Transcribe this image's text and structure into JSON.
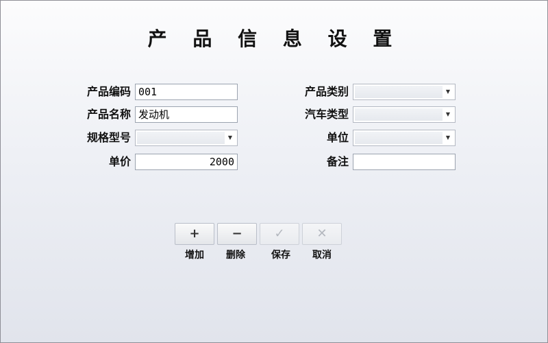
{
  "window": {
    "title": "产 品 信 息 设 置"
  },
  "form": {
    "product_code": {
      "label": "产品编码",
      "value": "001"
    },
    "product_name": {
      "label": "产品名称",
      "value": "发动机"
    },
    "spec_model": {
      "label": "规格型号",
      "value": ""
    },
    "unit_price": {
      "label": "单价",
      "value": "2000"
    },
    "product_category": {
      "label": "产品类别",
      "value": ""
    },
    "vehicle_type": {
      "label": "汽车类型",
      "value": ""
    },
    "unit": {
      "label": "单位",
      "value": ""
    },
    "remarks": {
      "label": "备注",
      "value": ""
    }
  },
  "toolbar": {
    "add": {
      "label": "增加",
      "glyph": "+",
      "icon": "plus-icon"
    },
    "delete": {
      "label": "删除",
      "glyph": "−",
      "icon": "minus-icon"
    },
    "save": {
      "label": "保存",
      "glyph": "✓",
      "icon": "check-icon"
    },
    "cancel": {
      "label": "取消",
      "glyph": "✕",
      "icon": "close-icon"
    }
  },
  "icons": {
    "dropdown": "chevron-down-icon"
  },
  "colors": {
    "background_top": "#fcfcfd",
    "background_bottom": "#e1e4ec",
    "field_border": "#9ba3af",
    "disabled_button_text": "#b4b8bf"
  }
}
